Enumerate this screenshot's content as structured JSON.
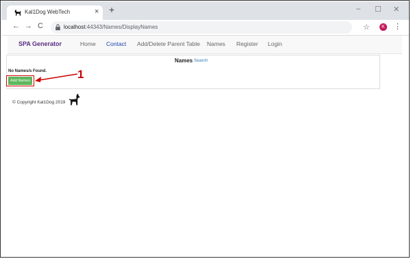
{
  "browser": {
    "tab_title": "Kal1Dog WebTech",
    "tab_close": "×",
    "new_tab": "+",
    "window_controls": {
      "minimize": "–",
      "maximize": "☐",
      "close": "✕"
    },
    "nav": {
      "back": "←",
      "forward": "→",
      "reload": "C"
    },
    "url_host": "localhost",
    "url_rest": ":44343/Names/DisplayNames",
    "star": "☆",
    "profile_initial": "K",
    "menu": "⋮"
  },
  "appnav": {
    "brand": "SPA Generator",
    "links": [
      "Home",
      "Contact",
      "Add/Delete Parent Table",
      "Names",
      "Register",
      "Login"
    ],
    "active_index": 1
  },
  "panel": {
    "title": "Names",
    "search_link": "Search",
    "empty_message": "No Names/s Found.",
    "add_button": "Add Names"
  },
  "annotation": {
    "callout_number": "1",
    "color": "#cc0000"
  },
  "footer": {
    "copyright": "© Copyright Kal1Dog 2019"
  },
  "colors": {
    "brand": "#5a2d82",
    "active_link": "#1a3fb0",
    "add_button": "#5cb85c",
    "link": "#337ab7"
  },
  "icons": [
    "dog-icon",
    "lock-icon",
    "star-icon",
    "profile-avatar",
    "kebab-menu-icon"
  ]
}
